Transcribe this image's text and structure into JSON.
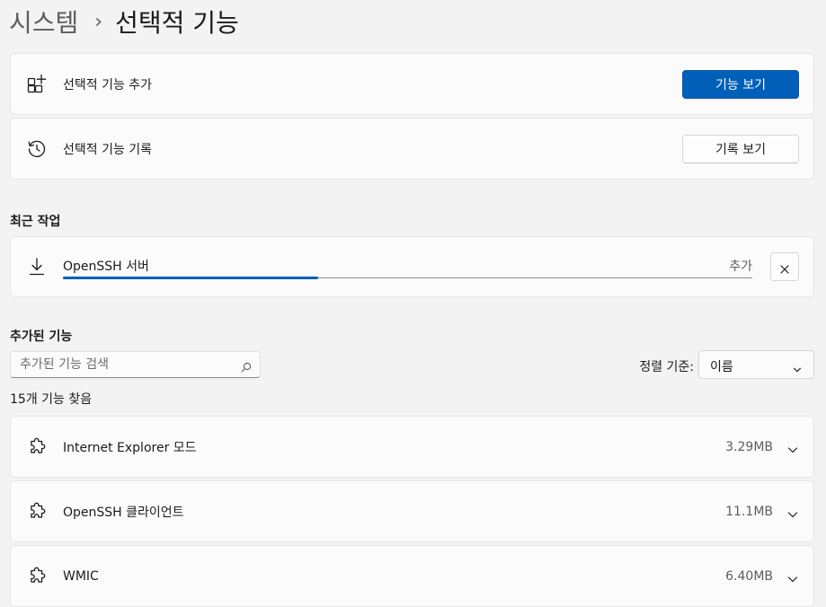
{
  "breadcrumb": {
    "parent": "시스템",
    "separator": "›",
    "current": "선택적 기능"
  },
  "actions": [
    {
      "icon": "add-grid-icon",
      "label": "선택적 기능 추가",
      "button": "기능 보기"
    },
    {
      "icon": "history-icon",
      "label": "선택적 기능 기록",
      "button": "기록 보기"
    }
  ],
  "recent": {
    "title": "최근 작업",
    "item": {
      "icon": "download-icon",
      "name": "OpenSSH 서버",
      "status": "추가",
      "progress": 0.37,
      "cancel_icon": "close-icon"
    }
  },
  "installed": {
    "title": "추가된 기능",
    "search_placeholder": "추가된 기능 검색",
    "sort_label": "정렬 기준:",
    "sort_value": "이름",
    "count_text": "15개 기능 찾음",
    "features": [
      {
        "name": "Internet Explorer 모드",
        "size": "3.29MB"
      },
      {
        "name": "OpenSSH 클라이언트",
        "size": "11.1MB"
      },
      {
        "name": "WMIC",
        "size": "6.40MB"
      }
    ]
  },
  "colors": {
    "accent": "#005fb8",
    "background": "#f3f3f3",
    "card": "#fbfbfb"
  }
}
